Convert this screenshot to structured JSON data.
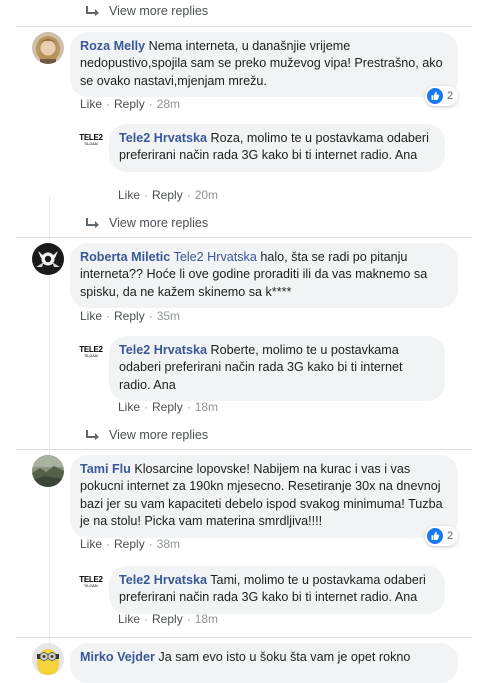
{
  "view_more_label": "View more replies",
  "actions": {
    "like": "Like",
    "reply": "Reply",
    "separator": "·"
  },
  "icons": {
    "reply_arrow": "reply-arrow-icon",
    "like": "like-icon",
    "tele2_logo_line1": "TELE2",
    "tele2_logo_line2": "TA-DAA!"
  },
  "colors": {
    "link": "#385898",
    "bubble": "#f2f3f5",
    "like": "#1877f2",
    "meta": "#90949c"
  },
  "comments": [
    {
      "author": "Roza Melly",
      "text": "Nema interneta, u današnjie vrijeme nedopustivo,spojila sam se preko muževog vipa! Prestrašno, ako se ovako nastavi,mjenjam mrežu.",
      "time": "28m",
      "reactions": "2",
      "reply": {
        "author": "Tele2 Hrvatska",
        "text": "Roza, molimo te u postavkama odaberi preferirani način rada 3G kako bi ti internet radio. Ana",
        "time": "20m"
      }
    },
    {
      "author": "Roberta Miletic",
      "mention": "Tele2 Hrvatska",
      "text": "halo, šta se radi po pitanju interneta?? Hoće li ove godine proraditi ili da vas maknemo sa spisku, da ne kažem skinemo sa k****",
      "time": "35m",
      "reply": {
        "author": "Tele2 Hrvatska",
        "text": "Roberte, molimo te u postavkama odaberi preferirani način rada 3G kako bi ti internet radio. Ana",
        "time": "18m"
      }
    },
    {
      "author": "Tami Flu",
      "text": "Klosarcine lopovske! Nabijem na kurac i vas i vas pokucni internet za 190kn mjesecno. Resetiranje 30x na dnevnoj bazi jer su vam kapaciteti debelo ispod svakog minimuma! Tuzba je na stolu! Picka vam materina smrdljiva!!!!",
      "time": "38m",
      "reactions": "2",
      "reply": {
        "author": "Tele2 Hrvatska",
        "text": "Tami, molimo te u postavkama odaberi preferirani način rada 3G kako bi ti internet radio. Ana",
        "time": "18m"
      }
    },
    {
      "author": "Mirko Vejder",
      "text": "Ja sam evo isto u šoku šta vam je opet rokno"
    }
  ]
}
